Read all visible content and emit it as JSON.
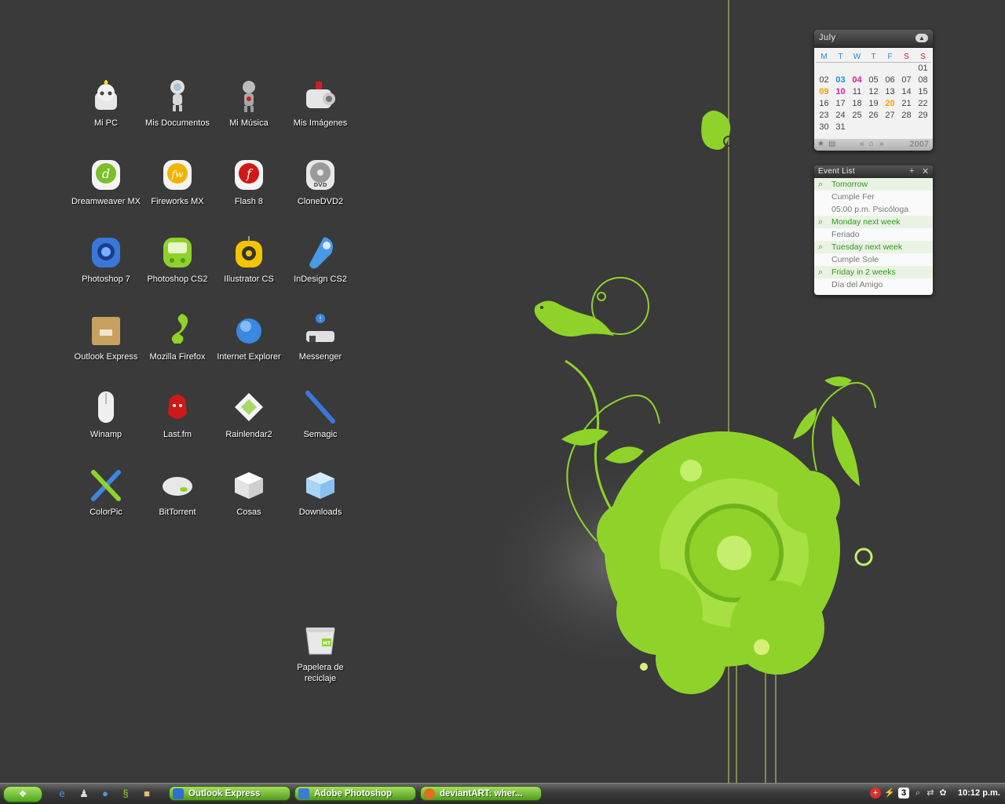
{
  "desktop": {
    "icons": [
      {
        "label": "Mi PC"
      },
      {
        "label": "Mis Documentos"
      },
      {
        "label": "Mi Música"
      },
      {
        "label": "Mis Imágenes"
      },
      {
        "label": "Dreamweaver MX"
      },
      {
        "label": "Fireworks MX"
      },
      {
        "label": "Flash 8"
      },
      {
        "label": "CloneDVD2"
      },
      {
        "label": "Photoshop 7"
      },
      {
        "label": "Photoshop CS2"
      },
      {
        "label": "Illustrator CS"
      },
      {
        "label": "InDesign CS2"
      },
      {
        "label": "Outlook Express"
      },
      {
        "label": "Mozilla Firefox"
      },
      {
        "label": "Internet Explorer"
      },
      {
        "label": "Messenger"
      },
      {
        "label": "Winamp"
      },
      {
        "label": "Last.fm"
      },
      {
        "label": "Rainlendar2"
      },
      {
        "label": "Semagic"
      },
      {
        "label": "ColorPic"
      },
      {
        "label": "BitTorrent"
      },
      {
        "label": "Cosas"
      },
      {
        "label": "Downloads"
      },
      {
        "label": "Papelera de reciclaje"
      }
    ]
  },
  "calendar": {
    "month": "July",
    "year": "2007",
    "weekdays": [
      "M",
      "T",
      "W",
      "T",
      "F",
      "S",
      "S"
    ],
    "days": [
      [
        "",
        "",
        "",
        "",
        "",
        "",
        "01"
      ],
      [
        "02",
        "03",
        "04",
        "05",
        "06",
        "07",
        "08"
      ],
      [
        "09",
        "10",
        "11",
        "12",
        "13",
        "14",
        "15"
      ],
      [
        "16",
        "17",
        "18",
        "19",
        "20",
        "21",
        "22"
      ],
      [
        "23",
        "24",
        "25",
        "26",
        "27",
        "28",
        "29"
      ],
      [
        "30",
        "31",
        "",
        "",
        "",
        "",
        ""
      ]
    ],
    "highlight_colors": {
      "03": "#1a8fe0",
      "04": "#e01aa0",
      "09": "#f0a000",
      "10": "#e01aa0",
      "20": "#f0a000"
    }
  },
  "events": {
    "title": "Event List",
    "items": [
      {
        "type": "header",
        "text": "Tomorrow"
      },
      {
        "type": "text",
        "text": "Cumple Fer"
      },
      {
        "type": "text",
        "text": "05:00 p.m. Psicóloga"
      },
      {
        "type": "header",
        "text": "Monday next week"
      },
      {
        "type": "text",
        "text": "Feriado"
      },
      {
        "type": "header",
        "text": "Tuesday next week"
      },
      {
        "type": "text",
        "text": "Cumple Sole"
      },
      {
        "type": "header",
        "text": "Friday in 2 weeks"
      },
      {
        "type": "text",
        "text": "Día del Amigo"
      }
    ]
  },
  "taskbar": {
    "tasks": [
      {
        "label": "Outlook Express",
        "icon": "outlook-icon",
        "color": "#2f6fd0"
      },
      {
        "label": "Adobe Photoshop",
        "icon": "photoshop-icon",
        "color": "#3a7bd5"
      },
      {
        "label": "deviantART: wher...",
        "icon": "firefox-icon",
        "color": "#e07020"
      }
    ],
    "tray_count": "3",
    "clock": "10:12 p.m."
  },
  "colors": {
    "accent": "#8fd32a",
    "desktop_bg": "#3a3a3a"
  }
}
